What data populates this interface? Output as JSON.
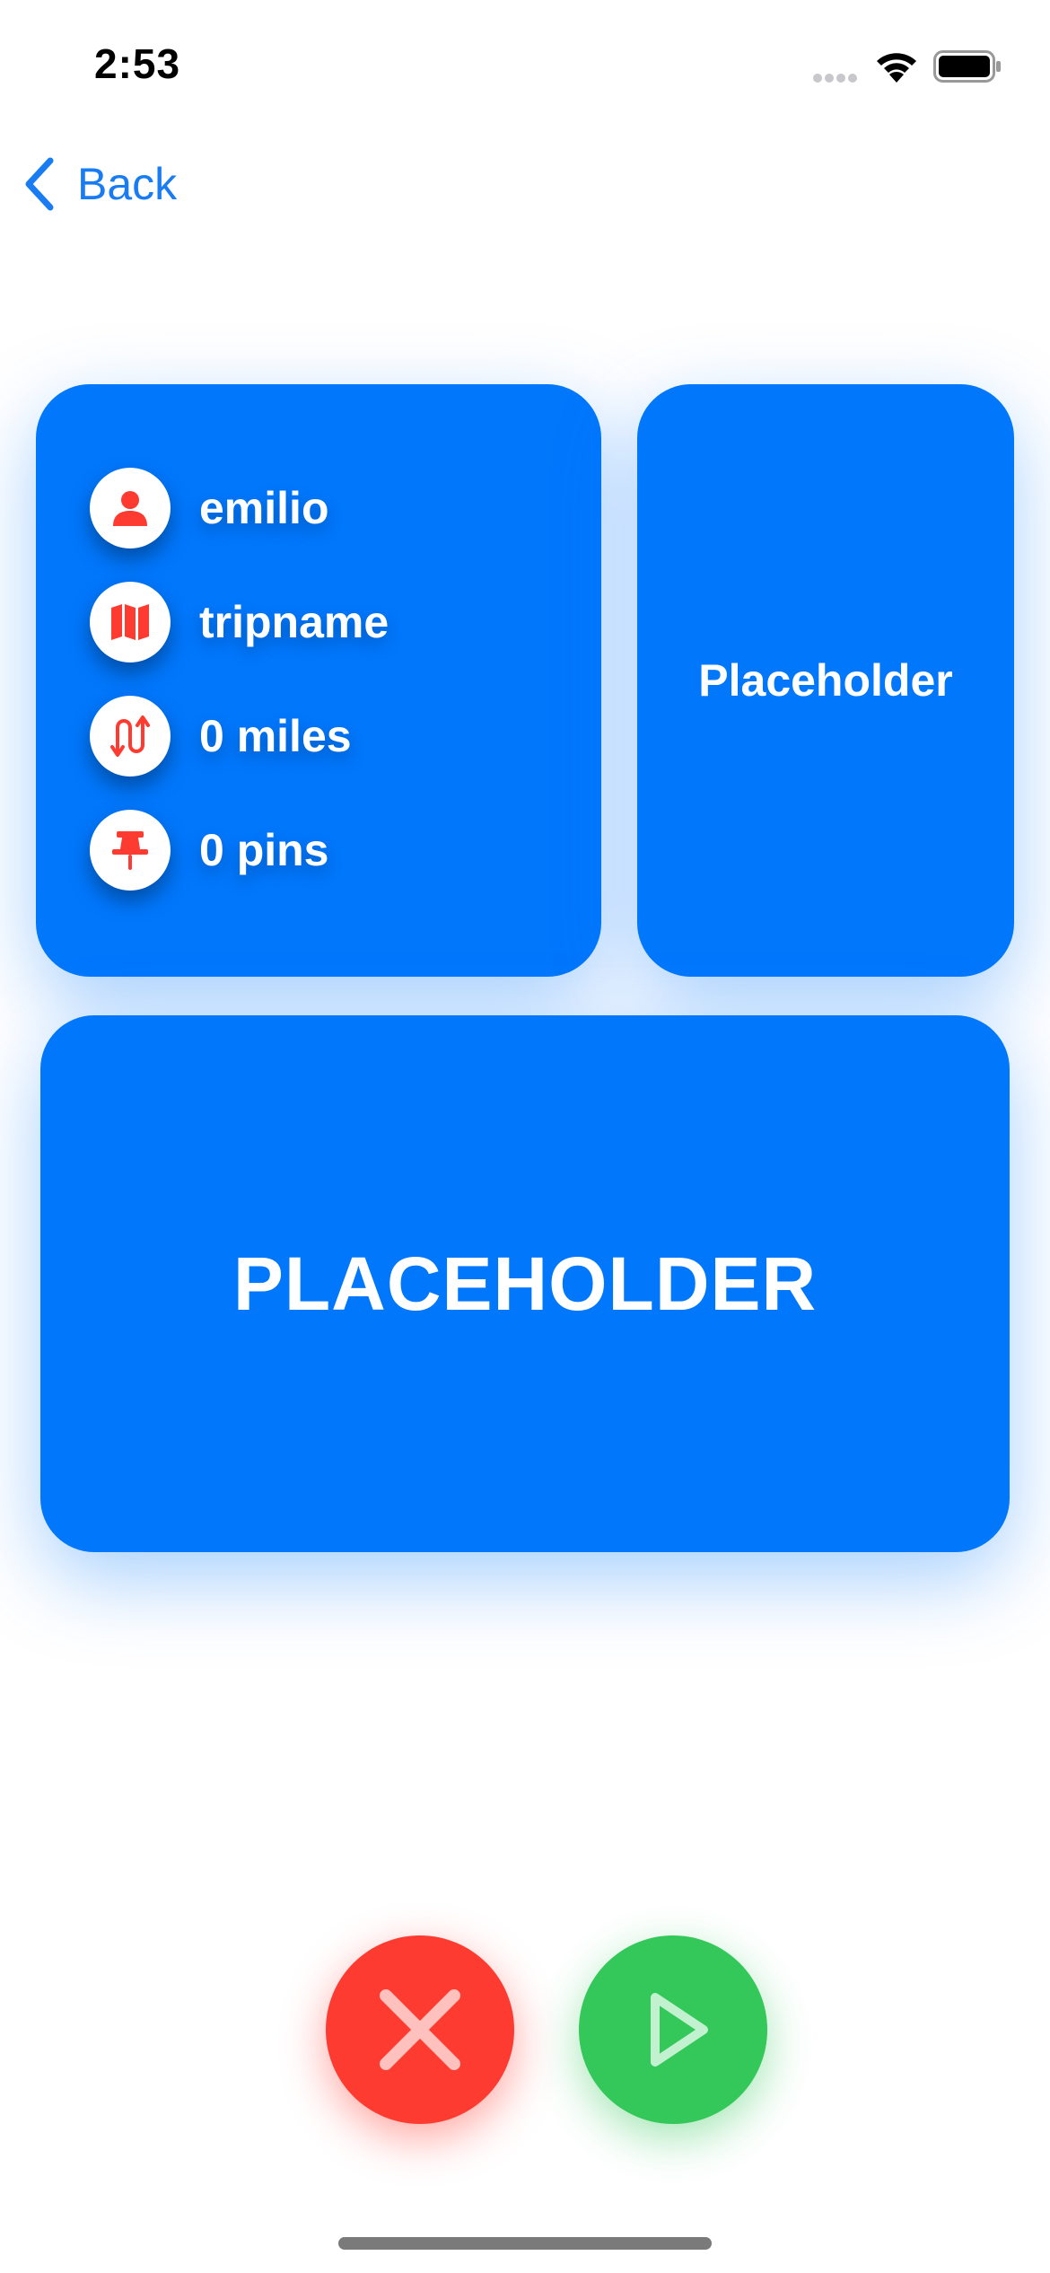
{
  "status_bar": {
    "time": "2:53"
  },
  "nav": {
    "back_label": "Back"
  },
  "info_card": {
    "items": [
      {
        "icon": "person-icon",
        "label": "emilio"
      },
      {
        "icon": "map-icon",
        "label": "tripname"
      },
      {
        "icon": "route-icon",
        "label": "0 miles"
      },
      {
        "icon": "pin-icon",
        "label": "0 pins"
      }
    ]
  },
  "side_card": {
    "label": "Placeholder"
  },
  "wide_card": {
    "label": "PLACEHOLDER"
  },
  "actions": {
    "cancel_icon": "close-icon",
    "start_icon": "play-icon"
  },
  "colors": {
    "card_blue": "#0177fc",
    "accent_red": "#fe3b30",
    "accent_green": "#34c759",
    "link_blue": "#1a7cf3"
  }
}
